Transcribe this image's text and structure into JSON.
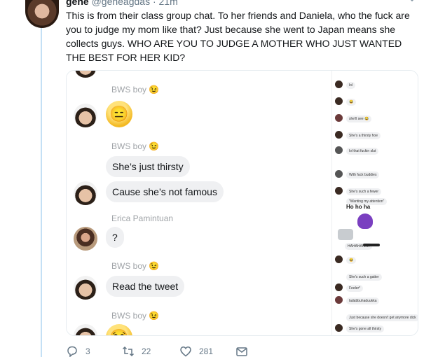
{
  "tweet": {
    "author_name": "gene",
    "author_handle": "@geneagdas · 21m",
    "text": "This is from their class group chat. To her friends and Daniela, who the fuck are you to judge my mom like that? Just because she went to Japan means she collects guys. WHO ARE YOU TO JUDGE A MOTHER WHO JUST WANTED THE BEST FOR HER KID?"
  },
  "chat": {
    "sender1": "BWS boy",
    "sender2": "BWS boy",
    "bubble1": "She’s just thirsty",
    "bubble2": "Cause she’s not famous",
    "sender3": "Erica Pamintuan",
    "bubble3": "?",
    "sender4": "BWS boy",
    "bubble4": "Read the tweet",
    "sender5": "BWS boy",
    "emoji_wink": "😉",
    "emoji_expressionless": "😑",
    "emoji_grin": "😂"
  },
  "side_panel": {
    "msg_lol": "lol",
    "msg_shell_see": "she'll see 😂",
    "msg_thirsty_hoe": "She's a thirsty hoe",
    "msg_fuckin_slut": "lol that fuckin slut",
    "msg_fuck_buddies": "With fuck buddies",
    "msg_fewer": "She's such a fewer",
    "msg_wanting_attention": "\"Wanting my attention\"",
    "sticker_text": "Ho ho ha",
    "msg_hahaha": "HAHAHAHAH",
    "msg_gatter": "She's such a gatter",
    "msg_feeler": "Feeler*",
    "msg_korean": "ladabbuhaduukka",
    "msg_just_because": "Just because she doesn't get anymore dick",
    "msg_gone_thirsty": "She's gone all thirsty"
  },
  "actions": {
    "reply_count": "3",
    "retweet_count": "22",
    "like_count": "281"
  },
  "colors": {
    "thread_line": "#c4e0f5",
    "bubble_bg": "#eff0f2",
    "meta_gray": "#657786",
    "sticker_purple": "#7a3fc0"
  },
  "icons": [
    "chevron-down-icon",
    "reply-icon",
    "retweet-icon",
    "like-icon",
    "message-icon"
  ]
}
